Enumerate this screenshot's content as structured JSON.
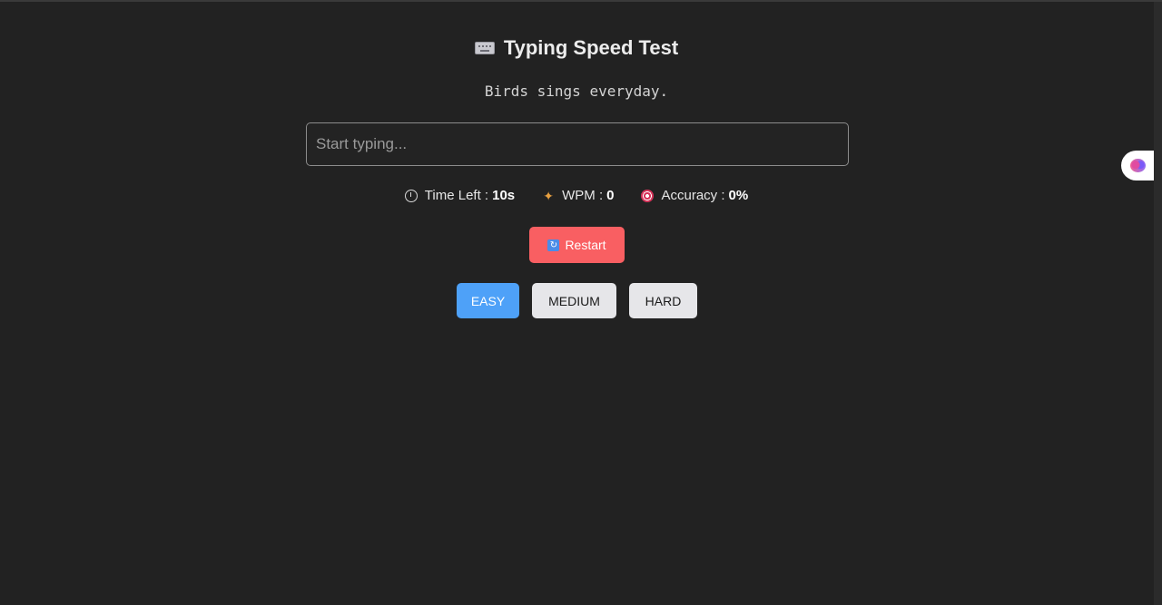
{
  "header": {
    "icon": "keyboard-icon",
    "title": "Typing Speed Test"
  },
  "prompt": {
    "sentence": "Birds sings everyday."
  },
  "input": {
    "placeholder": "Start typing...",
    "value": ""
  },
  "stats": {
    "time_label": "Time Left :",
    "time_value": "10s",
    "time_icon": "stopwatch-icon",
    "wpm_label": "WPM :",
    "wpm_value": "0",
    "wpm_icon": "runner-icon",
    "accuracy_label": "Accuracy :",
    "accuracy_value": "0%",
    "accuracy_icon": "target-icon"
  },
  "restart": {
    "label": "Restart",
    "icon": "refresh-icon",
    "color": "#f95f62"
  },
  "levels": {
    "selected": "EASY",
    "items": [
      {
        "label": "EASY"
      },
      {
        "label": "MEDIUM"
      },
      {
        "label": "HARD"
      }
    ],
    "active_color": "#4ea1f8"
  },
  "side_widget": {
    "icon": "brain-icon"
  }
}
